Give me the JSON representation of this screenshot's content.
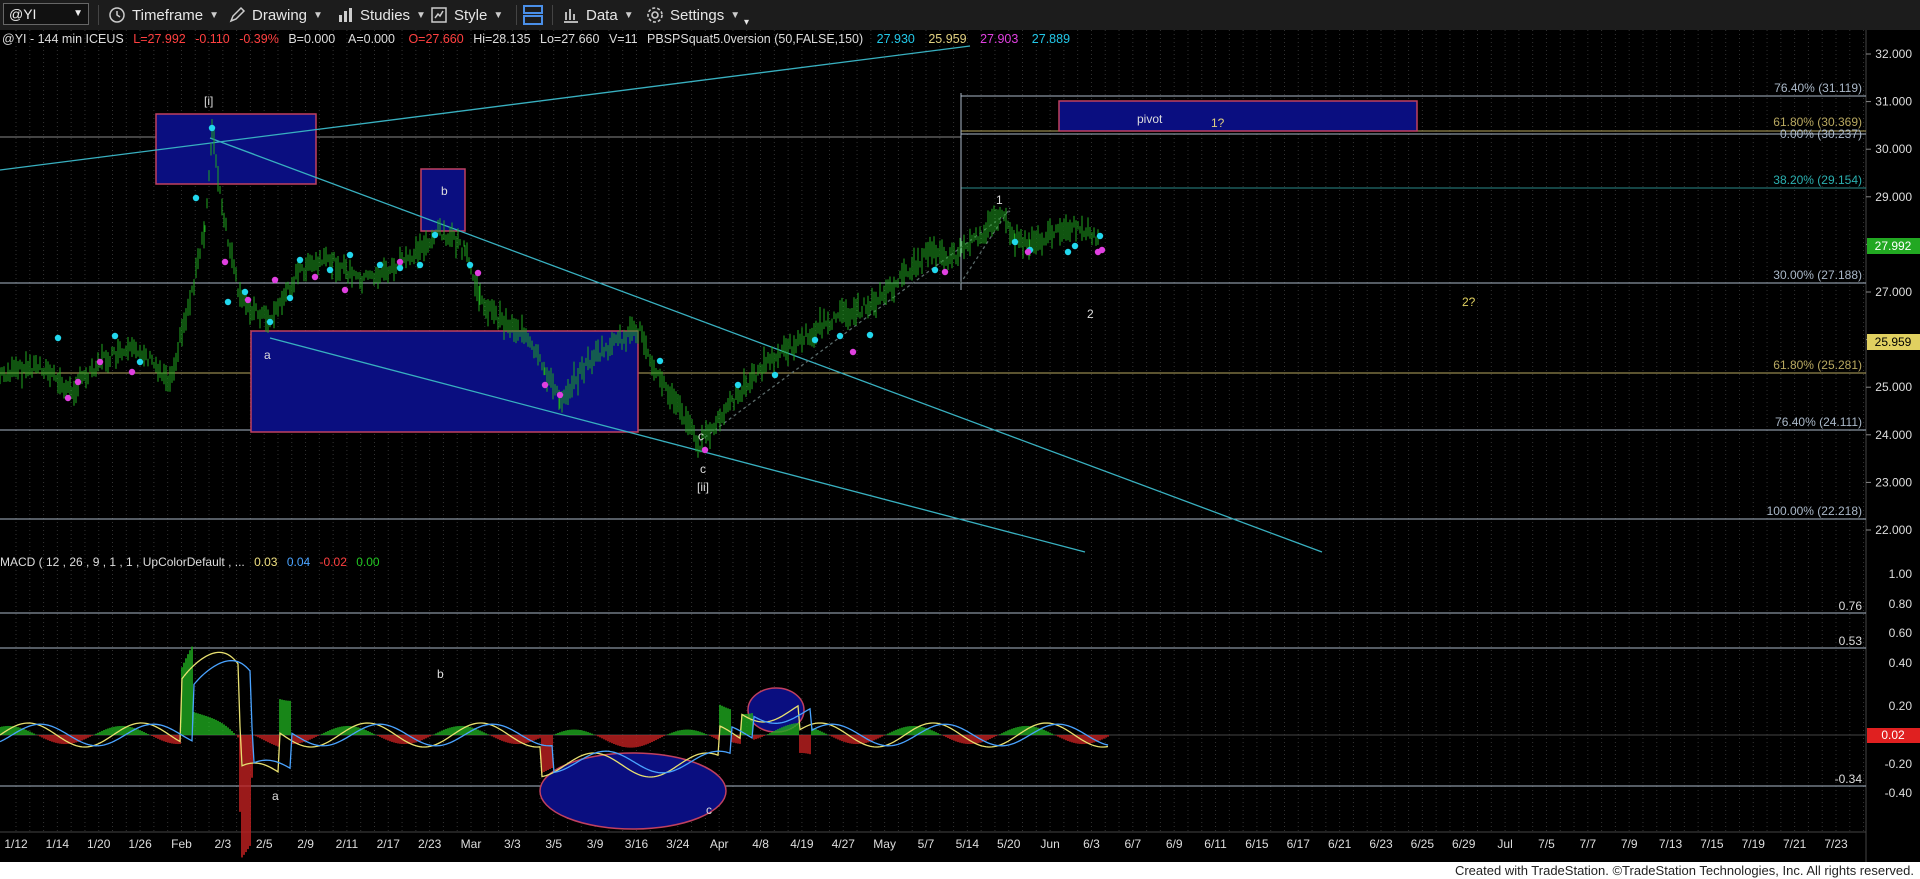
{
  "toolbar": {
    "symbol": "@YI",
    "timeframe": "Timeframe",
    "drawing": "Drawing",
    "studies": "Studies",
    "style": "Style",
    "data": "Data",
    "settings": "Settings"
  },
  "header": {
    "symbol_desc": "@YI - 144 min  ICEUS",
    "last": "L=27.992",
    "change": "-0.110",
    "change_pct": "-0.39%",
    "bid": "B=0.000",
    "ask": "A=0.000",
    "open": "O=27.660",
    "high": "Hi=28.135",
    "low": "Lo=27.660",
    "volume": "V=11",
    "study": "PBSPSquat5.0version (50,FALSE,150)",
    "study_vals": [
      "27.930",
      "25.959",
      "27.903",
      "27.889"
    ],
    "study_colors": [
      "#22c8e8",
      "#e0d080",
      "#e040e0",
      "#22c8e8"
    ]
  },
  "price_axis": {
    "labels": [
      "32.000",
      "31.000",
      "30.000",
      "29.000",
      "28.000",
      "27.000",
      "26.000",
      "25.000",
      "24.000",
      "23.000",
      "22.000"
    ],
    "last_tag": "27.992",
    "alt_tag": "25.959"
  },
  "date_axis": [
    "1/12",
    "1/14",
    "1/20",
    "1/26",
    "Feb",
    "2/3",
    "2/5",
    "2/9",
    "2/11",
    "2/17",
    "2/23",
    "Mar",
    "3/3",
    "3/5",
    "3/9",
    "3/16",
    "3/24",
    "Apr",
    "4/8",
    "4/19",
    "4/27",
    "May",
    "5/7",
    "5/14",
    "5/20",
    "Jun",
    "6/3",
    "6/7",
    "6/9",
    "6/11",
    "6/15",
    "6/17",
    "6/21",
    "6/23",
    "6/25",
    "6/29",
    "Jul",
    "7/5",
    "7/7",
    "7/9",
    "7/13",
    "7/15",
    "7/19",
    "7/21",
    "7/23"
  ],
  "fib_labels": {
    "f7640_top": "76.40% (31.119)",
    "f6180_top": "61.80% (30.369)",
    "f000": "0.00% (30.237)",
    "f3820": "38.20% (29.154)",
    "f000b": "30.00% (27.188)",
    "f6180": "61.80% (25.281)",
    "f7640": "76.40% (24.111)",
    "f100": "100.00% (22.218)"
  },
  "wave_labels": {
    "i": "[i]",
    "ii": "[ii]",
    "a": "a",
    "b": "b",
    "c": "c",
    "c2": "c",
    "one": "1",
    "two": "2",
    "pivot": "pivot",
    "one_q": "1?",
    "two_q": "2?"
  },
  "macd": {
    "title": "MACD ( 12 , 26 , 9 , 1 , 1 , UpColorDefault , ...",
    "vals": [
      "0.03",
      "0.04",
      "-0.02",
      "0.00"
    ],
    "val_colors": [
      "#f0e080",
      "#4aa3ff",
      "#ff4040",
      "#22c822"
    ],
    "axis": [
      "1.00",
      "0.80",
      "0.60",
      "0.40",
      "0.20",
      "-0.20",
      "-0.40"
    ],
    "lvl_076": "0.76",
    "lvl_053": "0.53",
    "lvl_034": "-0.34",
    "last_tag": "0.02",
    "labels": {
      "b": "b",
      "a": "a",
      "c": "c"
    }
  },
  "footer": "Created with TradeStation. ©TradeStation Technologies, Inc. All rights reserved."
}
